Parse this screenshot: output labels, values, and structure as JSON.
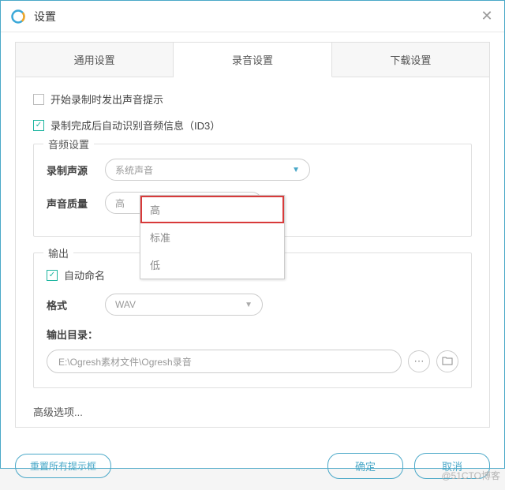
{
  "window": {
    "title": "设置"
  },
  "tabs": {
    "general": "通用设置",
    "record": "录音设置",
    "download": "下载设置"
  },
  "checkboxes": {
    "soundPrompt": "开始录制时发出声音提示",
    "autoId3": "录制完成后自动识别音频信息（ID3）"
  },
  "audio": {
    "legend": "音频设置",
    "sourceLabel": "录制声源",
    "sourceValue": "系统声音",
    "qualityLabel": "声音质量",
    "qualityValue": "高",
    "options": {
      "high": "高",
      "standard": "标准",
      "low": "低"
    }
  },
  "output": {
    "legend": "输出",
    "autoName": "自动命名",
    "formatLabel": "格式",
    "formatValue": "WAV",
    "dirLabel": "输出目录：",
    "dirValue": "E:\\Ogresh素材文件\\Ogresh录音"
  },
  "advanced": "高级选项...",
  "footer": {
    "reset": "重置所有提示框",
    "ok": "确定",
    "cancel": "取消"
  },
  "watermark": "@51CTO博客"
}
